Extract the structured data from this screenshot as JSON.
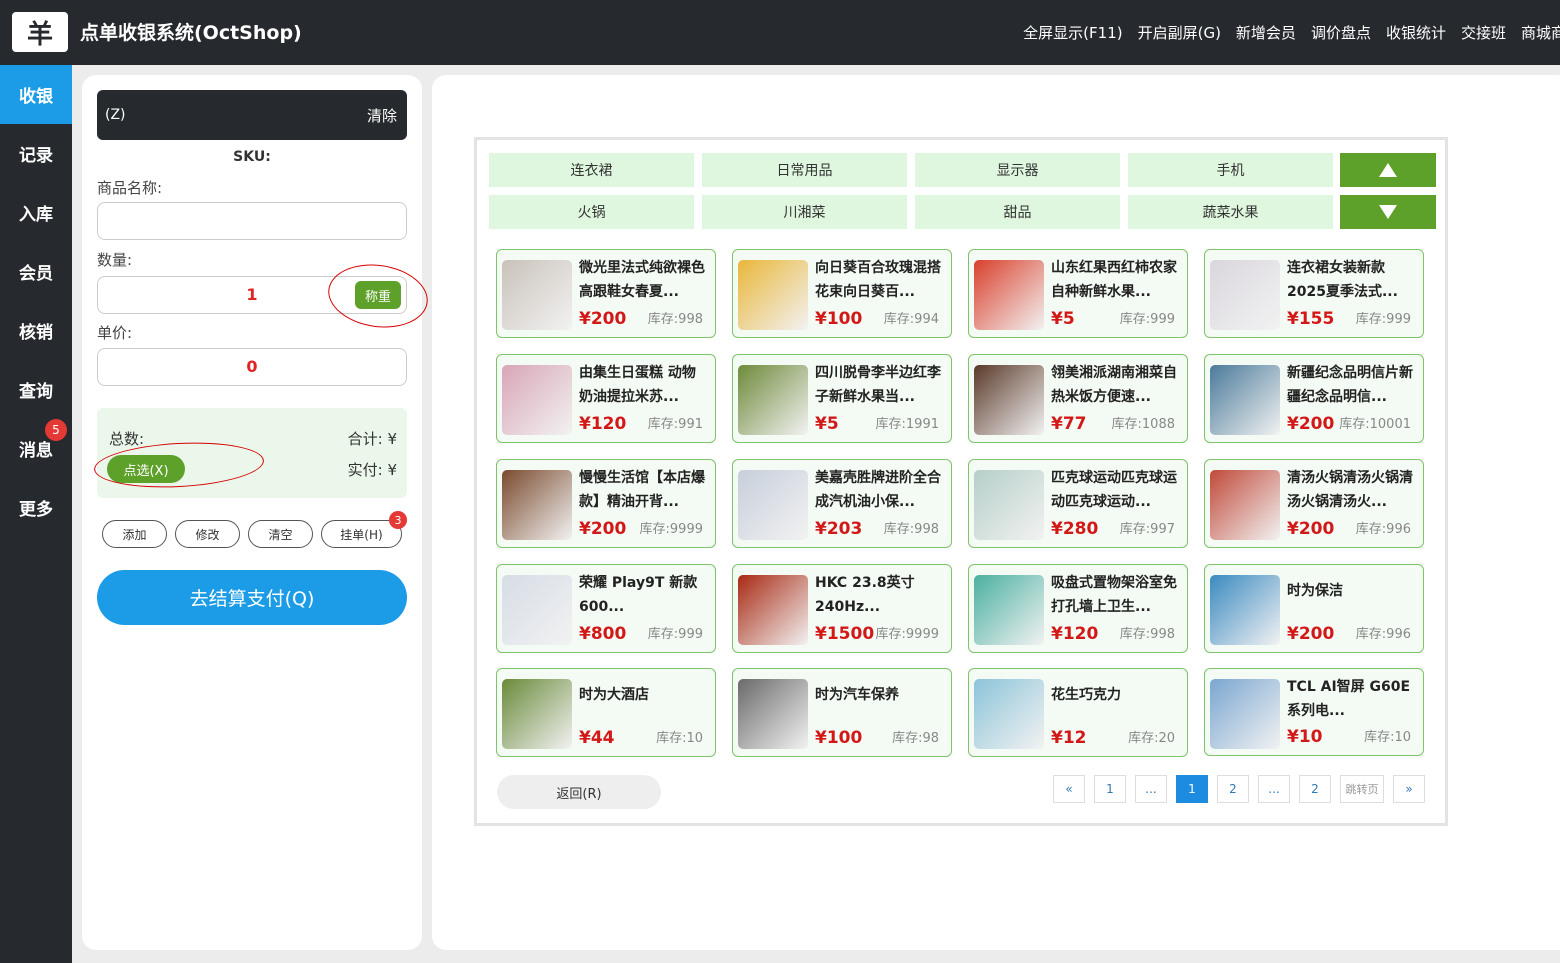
{
  "header": {
    "logo": "羊",
    "title": "点单收银系统(OctShop)",
    "nav": [
      "全屏显示(F11)",
      "开启副屏(G)",
      "新增会员",
      "调价盘点",
      "收银统计",
      "交接班",
      "商城商"
    ]
  },
  "sidebar": {
    "items": [
      {
        "label": "收银",
        "active": true
      },
      {
        "label": "记录"
      },
      {
        "label": "入库"
      },
      {
        "label": "会员"
      },
      {
        "label": "核销"
      },
      {
        "label": "查询"
      },
      {
        "label": "消息",
        "badge": "5"
      },
      {
        "label": "更多"
      }
    ]
  },
  "cashier": {
    "scan_label": "(Z)",
    "clear_label": "清除",
    "sku_label": "SKU:",
    "name_label": "商品名称:",
    "name_value": "",
    "qty_label": "数量:",
    "qty_value": "1",
    "weigh_label": "称重",
    "price_label": "单价:",
    "price_value": "0",
    "total_label": "总数:",
    "sum_label": "合计: ¥",
    "paid_label": "实付: ¥",
    "pick_label": "点选(X)",
    "ops": [
      "添加",
      "修改",
      "清空",
      "挂单(H)"
    ],
    "hold_badge": "3",
    "pay_label": "去结算支付(Q)"
  },
  "categories": {
    "row1": [
      "连衣裙",
      "日常用品",
      "显示器",
      "手机"
    ],
    "row2": [
      "火锅",
      "川湘菜",
      "甜品",
      "蔬菜水果"
    ]
  },
  "products": [
    {
      "name": "微光里法式纯欲裸色高跟鞋女春夏...",
      "price": "¥200",
      "stock": "库存:998",
      "color": "#c9c2ba"
    },
    {
      "name": "向日葵百合玫瑰混搭花束向日葵百...",
      "price": "¥100",
      "stock": "库存:994",
      "color": "#e9b73a"
    },
    {
      "name": "山东红果西红柿农家自种新鲜水果...",
      "price": "¥5",
      "stock": "库存:999",
      "color": "#d9402c"
    },
    {
      "name": "连衣裙女装新款2025夏季法式...",
      "price": "¥155",
      "stock": "库存:999",
      "color": "#d9d6dd"
    },
    {
      "name": "由集生日蛋糕 动物奶油提拉米苏...",
      "price": "¥120",
      "stock": "库存:991",
      "color": "#d8a6b6"
    },
    {
      "name": "四川脱骨李半边红李子新鲜水果当...",
      "price": "¥5",
      "stock": "库存:1991",
      "color": "#6e8a3a"
    },
    {
      "name": "翎美湘派湖南湘菜自热米饭方便速...",
      "price": "¥77",
      "stock": "库存:1088",
      "color": "#5a3a2a"
    },
    {
      "name": "新疆纪念品明信片新疆纪念品明信...",
      "price": "¥200",
      "stock": "库存:10001",
      "color": "#4b7a9a"
    },
    {
      "name": "慢慢生活馆【本店爆款】精油开背...",
      "price": "¥200",
      "stock": "库存:9999",
      "color": "#7a4a2e"
    },
    {
      "name": "美嘉壳胜牌进阶全合成汽机油小保...",
      "price": "¥203",
      "stock": "库存:998",
      "color": "#c7cfdb"
    },
    {
      "name": "匹克球运动匹克球运动匹克球运动...",
      "price": "¥280",
      "stock": "库存:997",
      "color": "#b5cfc8"
    },
    {
      "name": "清汤火锅清汤火锅清汤火锅清汤火...",
      "price": "¥200",
      "stock": "库存:996",
      "color": "#c04a3a"
    },
    {
      "name": "荣耀 Play9T 新款600...",
      "price": "¥800",
      "stock": "库存:999",
      "color": "#d6dde6"
    },
    {
      "name": "HKC 23.8英寸240Hz...",
      "price": "¥1500",
      "stock": "库存:9999",
      "color": "#a82a14"
    },
    {
      "name": "吸盘式置物架浴室免打孔墙上卫生...",
      "price": "¥120",
      "stock": "库存:998",
      "color": "#4ab0a0"
    },
    {
      "name": "时为保洁",
      "price": "¥200",
      "stock": "库存:996",
      "color": "#3a8ac0"
    },
    {
      "name": "时为大酒店",
      "price": "¥44",
      "stock": "库存:10",
      "color": "#6a8a3a"
    },
    {
      "name": "时为汽车保养",
      "price": "¥100",
      "stock": "库存:98",
      "color": "#6a6a6a"
    },
    {
      "name": "花生巧克力",
      "price": "¥12",
      "stock": "库存:20",
      "color": "#8cc4d8"
    },
    {
      "name": "TCL AI智屏 G60E 系列电...",
      "price": "¥10",
      "stock": "库存:10",
      "color": "#7aa6d0"
    }
  ],
  "footer": {
    "back_label": "返回(R)",
    "pager": [
      "«",
      "1",
      "...",
      "1",
      "2",
      "...",
      "2",
      "跳转页",
      "»"
    ],
    "current_page": "1"
  }
}
